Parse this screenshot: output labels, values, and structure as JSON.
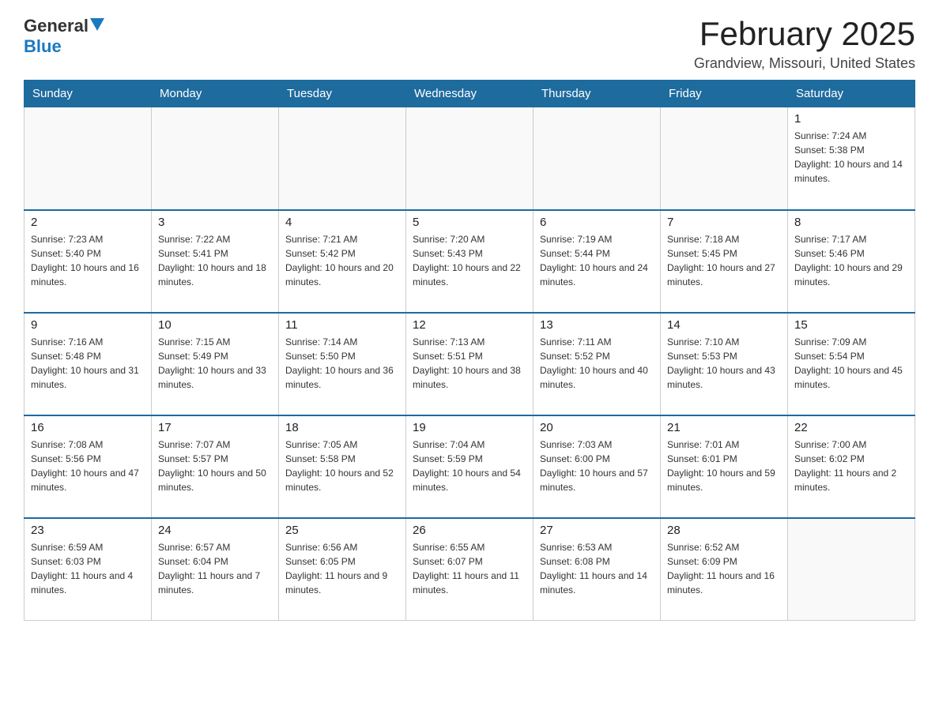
{
  "header": {
    "logo_general": "General",
    "logo_blue": "Blue",
    "month_title": "February 2025",
    "location": "Grandview, Missouri, United States"
  },
  "days_of_week": [
    "Sunday",
    "Monday",
    "Tuesday",
    "Wednesday",
    "Thursday",
    "Friday",
    "Saturday"
  ],
  "weeks": [
    [
      {
        "day": "",
        "info": ""
      },
      {
        "day": "",
        "info": ""
      },
      {
        "day": "",
        "info": ""
      },
      {
        "day": "",
        "info": ""
      },
      {
        "day": "",
        "info": ""
      },
      {
        "day": "",
        "info": ""
      },
      {
        "day": "1",
        "info": "Sunrise: 7:24 AM\nSunset: 5:38 PM\nDaylight: 10 hours and 14 minutes."
      }
    ],
    [
      {
        "day": "2",
        "info": "Sunrise: 7:23 AM\nSunset: 5:40 PM\nDaylight: 10 hours and 16 minutes."
      },
      {
        "day": "3",
        "info": "Sunrise: 7:22 AM\nSunset: 5:41 PM\nDaylight: 10 hours and 18 minutes."
      },
      {
        "day": "4",
        "info": "Sunrise: 7:21 AM\nSunset: 5:42 PM\nDaylight: 10 hours and 20 minutes."
      },
      {
        "day": "5",
        "info": "Sunrise: 7:20 AM\nSunset: 5:43 PM\nDaylight: 10 hours and 22 minutes."
      },
      {
        "day": "6",
        "info": "Sunrise: 7:19 AM\nSunset: 5:44 PM\nDaylight: 10 hours and 24 minutes."
      },
      {
        "day": "7",
        "info": "Sunrise: 7:18 AM\nSunset: 5:45 PM\nDaylight: 10 hours and 27 minutes."
      },
      {
        "day": "8",
        "info": "Sunrise: 7:17 AM\nSunset: 5:46 PM\nDaylight: 10 hours and 29 minutes."
      }
    ],
    [
      {
        "day": "9",
        "info": "Sunrise: 7:16 AM\nSunset: 5:48 PM\nDaylight: 10 hours and 31 minutes."
      },
      {
        "day": "10",
        "info": "Sunrise: 7:15 AM\nSunset: 5:49 PM\nDaylight: 10 hours and 33 minutes."
      },
      {
        "day": "11",
        "info": "Sunrise: 7:14 AM\nSunset: 5:50 PM\nDaylight: 10 hours and 36 minutes."
      },
      {
        "day": "12",
        "info": "Sunrise: 7:13 AM\nSunset: 5:51 PM\nDaylight: 10 hours and 38 minutes."
      },
      {
        "day": "13",
        "info": "Sunrise: 7:11 AM\nSunset: 5:52 PM\nDaylight: 10 hours and 40 minutes."
      },
      {
        "day": "14",
        "info": "Sunrise: 7:10 AM\nSunset: 5:53 PM\nDaylight: 10 hours and 43 minutes."
      },
      {
        "day": "15",
        "info": "Sunrise: 7:09 AM\nSunset: 5:54 PM\nDaylight: 10 hours and 45 minutes."
      }
    ],
    [
      {
        "day": "16",
        "info": "Sunrise: 7:08 AM\nSunset: 5:56 PM\nDaylight: 10 hours and 47 minutes."
      },
      {
        "day": "17",
        "info": "Sunrise: 7:07 AM\nSunset: 5:57 PM\nDaylight: 10 hours and 50 minutes."
      },
      {
        "day": "18",
        "info": "Sunrise: 7:05 AM\nSunset: 5:58 PM\nDaylight: 10 hours and 52 minutes."
      },
      {
        "day": "19",
        "info": "Sunrise: 7:04 AM\nSunset: 5:59 PM\nDaylight: 10 hours and 54 minutes."
      },
      {
        "day": "20",
        "info": "Sunrise: 7:03 AM\nSunset: 6:00 PM\nDaylight: 10 hours and 57 minutes."
      },
      {
        "day": "21",
        "info": "Sunrise: 7:01 AM\nSunset: 6:01 PM\nDaylight: 10 hours and 59 minutes."
      },
      {
        "day": "22",
        "info": "Sunrise: 7:00 AM\nSunset: 6:02 PM\nDaylight: 11 hours and 2 minutes."
      }
    ],
    [
      {
        "day": "23",
        "info": "Sunrise: 6:59 AM\nSunset: 6:03 PM\nDaylight: 11 hours and 4 minutes."
      },
      {
        "day": "24",
        "info": "Sunrise: 6:57 AM\nSunset: 6:04 PM\nDaylight: 11 hours and 7 minutes."
      },
      {
        "day": "25",
        "info": "Sunrise: 6:56 AM\nSunset: 6:05 PM\nDaylight: 11 hours and 9 minutes."
      },
      {
        "day": "26",
        "info": "Sunrise: 6:55 AM\nSunset: 6:07 PM\nDaylight: 11 hours and 11 minutes."
      },
      {
        "day": "27",
        "info": "Sunrise: 6:53 AM\nSunset: 6:08 PM\nDaylight: 11 hours and 14 minutes."
      },
      {
        "day": "28",
        "info": "Sunrise: 6:52 AM\nSunset: 6:09 PM\nDaylight: 11 hours and 16 minutes."
      },
      {
        "day": "",
        "info": ""
      }
    ]
  ]
}
